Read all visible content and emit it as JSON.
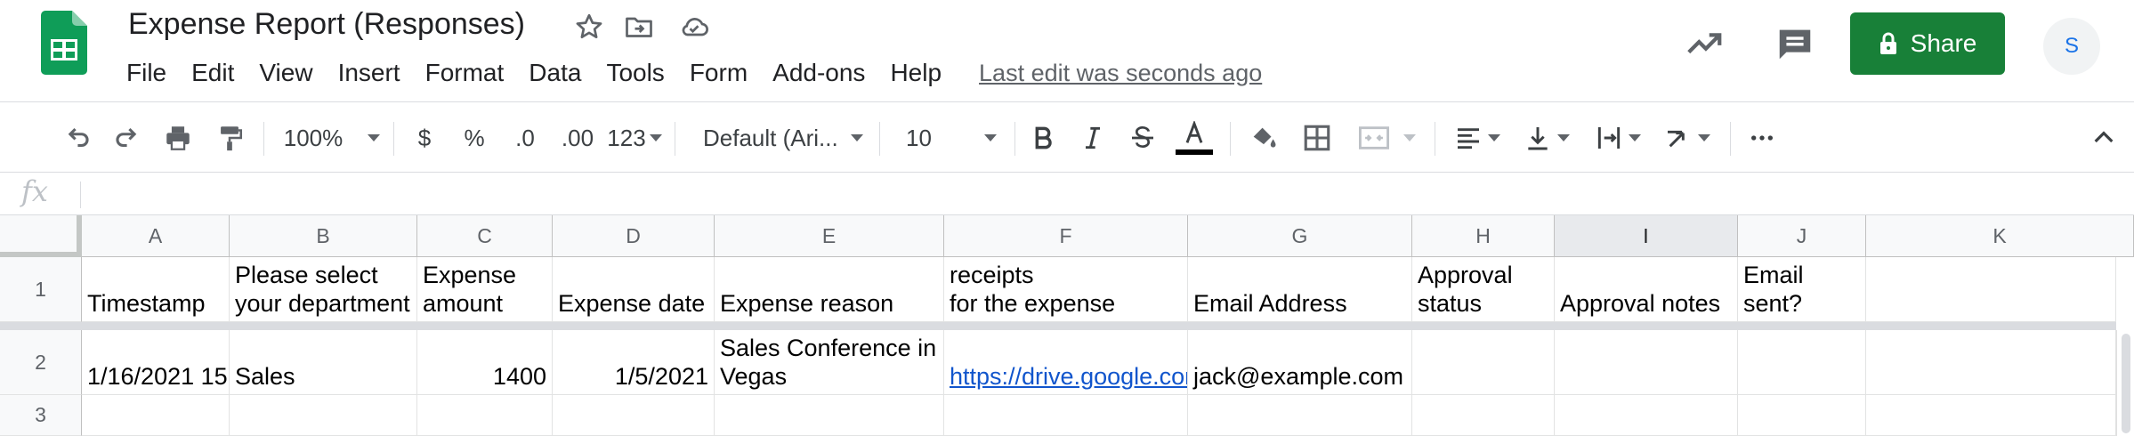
{
  "app": {
    "doc_title": "Expense Report (Responses)",
    "menus": [
      "File",
      "Edit",
      "View",
      "Insert",
      "Format",
      "Data",
      "Tools",
      "Form",
      "Add-ons",
      "Help"
    ],
    "last_edit": "Last edit was seconds ago",
    "share_label": "Share",
    "avatar_initial": "S",
    "colors": {
      "brand_green": "#188038",
      "link_blue": "#1155cc",
      "avatar_text": "#1a73e8"
    }
  },
  "toolbar": {
    "zoom": "100%",
    "currency": "$",
    "percent": "%",
    "decrease_decimal": ".0",
    "increase_decimal": ".00",
    "more_formats": "123",
    "font": "Default (Ari...",
    "font_size": "10",
    "icons": [
      "undo-icon",
      "redo-icon",
      "print-icon",
      "paint-format-icon",
      "bold-icon",
      "italic-icon",
      "strikethrough-icon",
      "text-color-icon",
      "fill-color-icon",
      "borders-icon",
      "merge-cells-icon",
      "align-left-icon",
      "valign-bottom-icon",
      "text-wrap-icon",
      "text-rotate-icon",
      "more-icon",
      "collapse-icon"
    ]
  },
  "formula_bar": {
    "fx": "fx",
    "value": ""
  },
  "sheet": {
    "columns": [
      "A",
      "B",
      "C",
      "D",
      "E",
      "F",
      "G",
      "H",
      "I",
      "J",
      "K"
    ],
    "selected_column": "I",
    "rows": [
      "1",
      "2",
      "3"
    ],
    "headers": [
      "Timestamp",
      "Please select\nyour department",
      "Expense\namount",
      "Expense date",
      "Expense reason",
      "Please attach receipts\nfor the expense",
      "Email Address",
      "Approval\nstatus",
      "Approval notes",
      "Email\nsent?",
      ""
    ],
    "row2": {
      "timestamp": "1/16/2021 15:",
      "department": "Sales",
      "amount": "1400",
      "date": "1/5/2021",
      "reason": "Sales Conference in\nVegas",
      "receipt": "https://drive.google.com",
      "email": "jack@example.com",
      "status": "",
      "notes": "",
      "sent": "",
      "k": ""
    }
  }
}
